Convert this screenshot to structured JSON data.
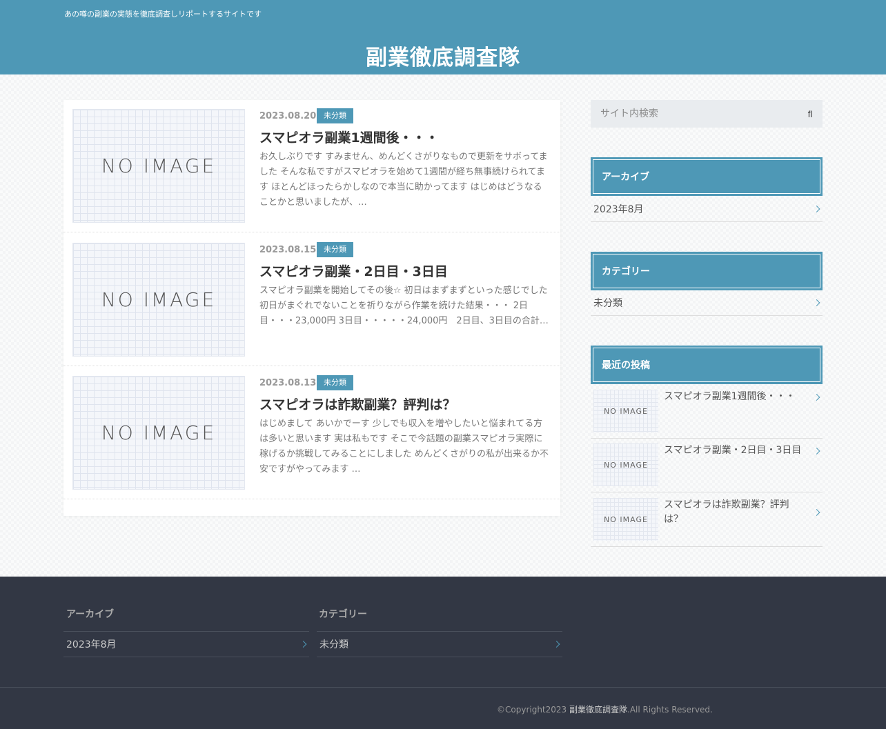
{
  "header": {
    "tagline": "あの噂の副業の実態を徹底調査しリポートするサイトです",
    "site_title": "副業徹底調査隊"
  },
  "posts": [
    {
      "thumb": "NO IMAGE",
      "date": "2023.08.20",
      "category": "未分類",
      "title": "スマピオラ副業1週間後・・・",
      "excerpt": "お久しぶりです すみません、めんどくさがりなもので更新をサボってました そんな私ですがスマピオラを始めて1週間が経ち無事続けられてます ほとんどほったらかしなので本当に助かってます はじめはどうなることかと思いましたが、…"
    },
    {
      "thumb": "NO IMAGE",
      "date": "2023.08.15",
      "category": "未分類",
      "title": "スマピオラ副業・2日目・3日目",
      "excerpt": "スマピオラ副業を開始してその後☆ 初日はまずまずといった感じでした 初日がまぐれでないことを祈りながら作業を続けた結果・・・ 2日目・・・23,000円 3日目・・・・・24,000円　2日目、3日目の合計…"
    },
    {
      "thumb": "NO IMAGE",
      "date": "2023.08.13",
      "category": "未分類",
      "title": "スマピオラは詐欺副業？評判は？",
      "excerpt": "はじめまして あいかでーす 少しでも収入を増やしたいと悩まれてる方は多いと思います 実は私もです そこで今話題の副業スマピオラ実際に稼げるか挑戦してみることにしました めんどくさがりの私が出来るか不安ですがやってみます …"
    }
  ],
  "sidebar": {
    "search_placeholder": "サイト内検索",
    "search_button_icon": "search-icon",
    "search_button_glyph": "fl",
    "archive": {
      "heading": "アーカイブ",
      "items": [
        "2023年8月"
      ]
    },
    "category": {
      "heading": "カテゴリー",
      "items": [
        "未分類"
      ]
    },
    "recent": {
      "heading": "最近の投稿",
      "thumb": "NO IMAGE",
      "items": [
        "スマピオラ副業1週間後・・・",
        "スマピオラ副業・2日目・3日目",
        "スマピオラは詐欺副業？評判は？"
      ]
    }
  },
  "footer": {
    "archive": {
      "heading": "アーカイブ",
      "items": [
        "2023年8月"
      ]
    },
    "category": {
      "heading": "カテゴリー",
      "items": [
        "未分類"
      ]
    },
    "copyright_prefix": "©Copyright2023 ",
    "copyright_site": "副業徹底調査隊",
    "copyright_suffix": ".All Rights Reserved."
  },
  "colors": {
    "accent": "#4e98b6",
    "footer_bg": "#323744"
  }
}
